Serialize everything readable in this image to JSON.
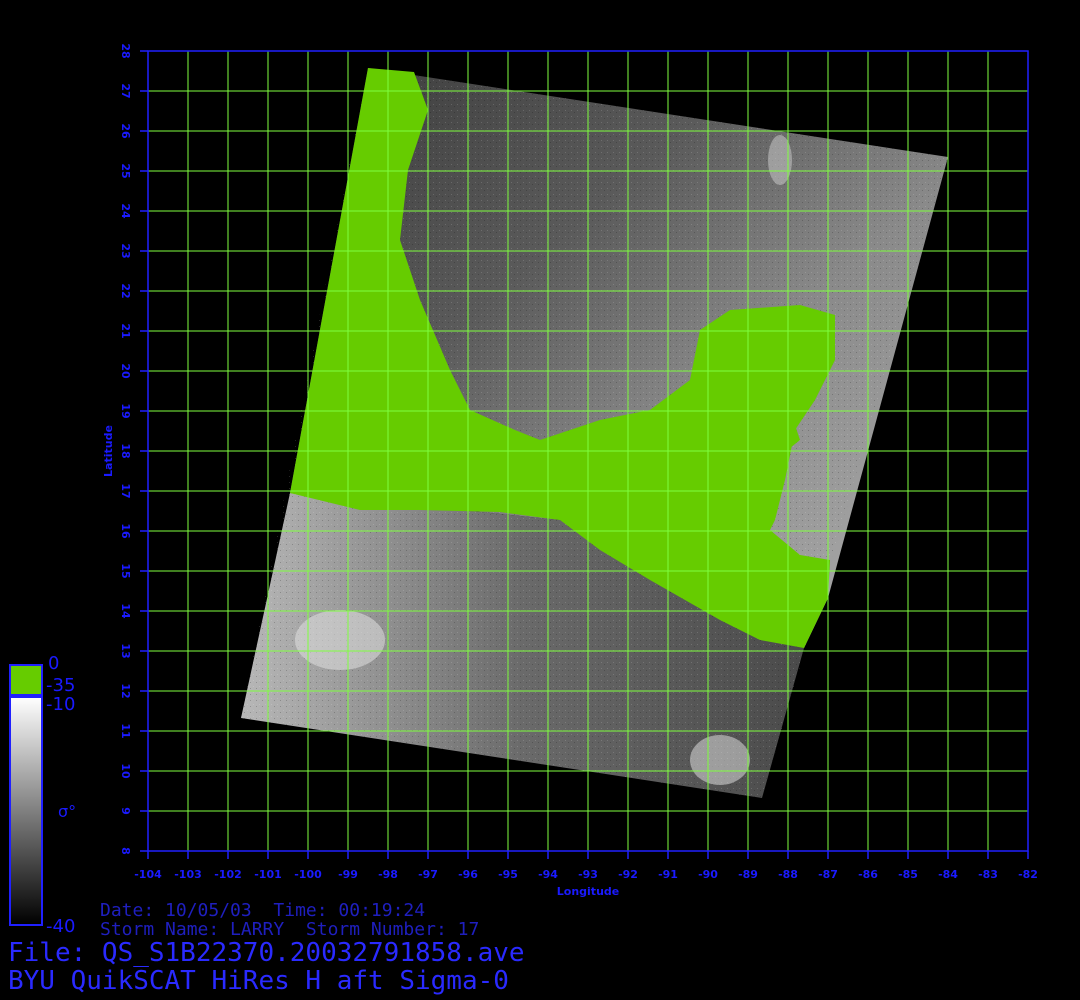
{
  "figure": {
    "file_line": "File: QS_S1B22370.20032791858.ave",
    "product_line": "BYU QuikSCAT HiRes H aft Sigma-0",
    "date_line": "Date: 10/05/03  Time: 00:19:24",
    "storm_line": "Storm Name: LARRY  Storm Number: 17"
  },
  "axes": {
    "xlabel": "Longitude",
    "ylabel": "Latitude",
    "lon_ticks": [
      "-104",
      "-103",
      "-102",
      "-101",
      "-100",
      "-99",
      "-98",
      "-97",
      "-96",
      "-95",
      "-94",
      "-93",
      "-92",
      "-91",
      "-90",
      "-89",
      "-88",
      "-87",
      "-86",
      "-85",
      "-84",
      "-83",
      "-82"
    ],
    "lat_ticks": [
      "8",
      "9",
      "10",
      "11",
      "12",
      "13",
      "14",
      "15",
      "16",
      "17",
      "18",
      "19",
      "20",
      "21",
      "22",
      "23",
      "24",
      "25",
      "26",
      "27",
      "28"
    ]
  },
  "colorbar": {
    "land_top": "0",
    "land_bottom": "-35",
    "ocean_top": "-10",
    "ocean_bottom": "-40",
    "symbol": "σ°"
  },
  "colors": {
    "axis": "#2020ff",
    "grid": "#7fff3f",
    "land": "#66cc00",
    "text": "#1f1fbf"
  }
}
